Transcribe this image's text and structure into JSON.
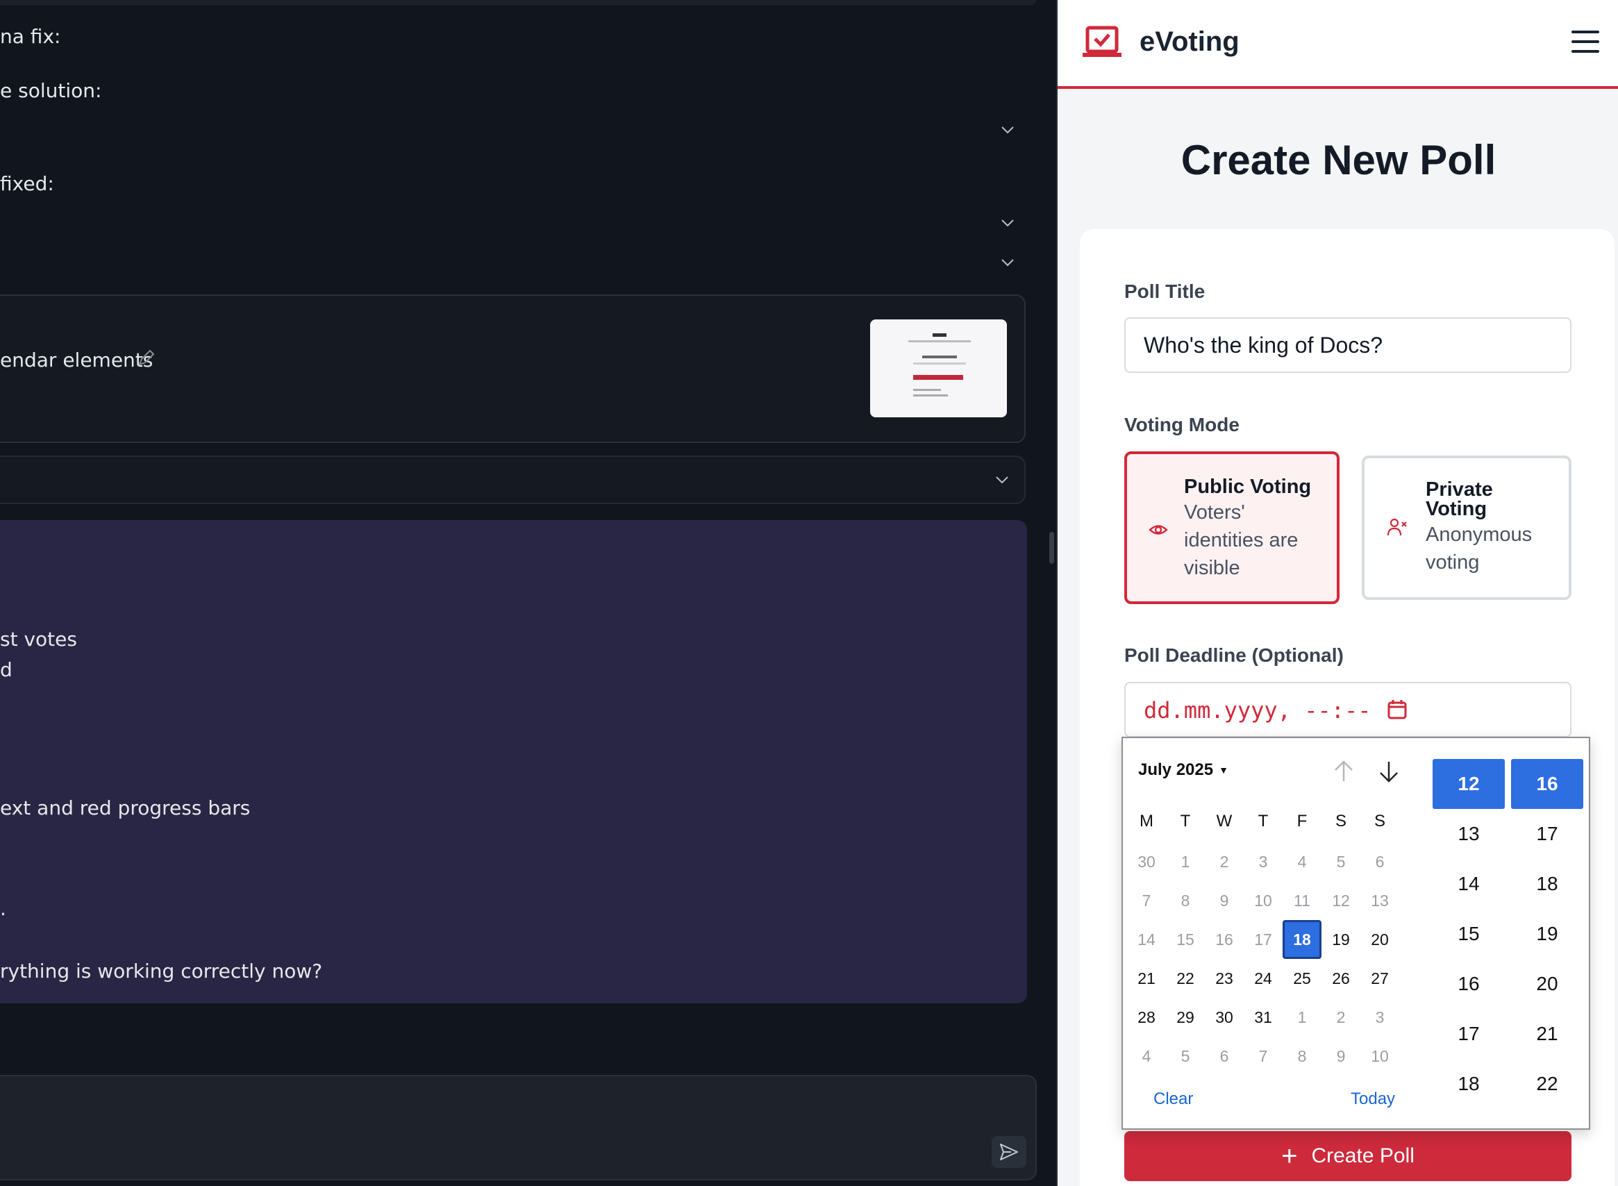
{
  "left_pane": {
    "lines": [
      {
        "text": "na fix:"
      },
      {
        "text": "e solution:"
      },
      {
        "text": "fixed:"
      },
      {
        "text": "endar elements"
      },
      {
        "text": "st votes"
      },
      {
        "text": "d"
      },
      {
        "text": "ext and red progress bars"
      },
      {
        "text": "."
      },
      {
        "text": "rything is working correctly now?"
      }
    ]
  },
  "app": {
    "brand": "eVoting",
    "page_title": "Create New Poll",
    "colors": {
      "accent": "#cd2a3c",
      "selection": "#2d6ee0"
    },
    "form": {
      "title_label": "Poll Title",
      "title_value": "Who's the king of Docs?",
      "mode_label": "Voting Mode",
      "modes": [
        {
          "name": "Public Voting",
          "description_lines": [
            "Voters'",
            "identities are",
            "visible"
          ],
          "icon": "eye-icon",
          "selected": true
        },
        {
          "name_lines": [
            "Private",
            "Voting"
          ],
          "description_lines": [
            "Anonymous",
            "voting"
          ],
          "icon": "user-x-icon",
          "selected": false
        }
      ],
      "deadline_label": "Poll Deadline (Optional)",
      "deadline_placeholder": "dd.mm.yyyy, --:--",
      "submit_label": "Create Poll"
    }
  },
  "picker": {
    "month_label": "July 2025",
    "weekdays": [
      "M",
      "T",
      "W",
      "T",
      "F",
      "S",
      "S"
    ],
    "weeks": [
      [
        {
          "d": "30",
          "s": "out"
        },
        {
          "d": "1",
          "s": "dis"
        },
        {
          "d": "2",
          "s": "dis"
        },
        {
          "d": "3",
          "s": "dis"
        },
        {
          "d": "4",
          "s": "dis"
        },
        {
          "d": "5",
          "s": "dis"
        },
        {
          "d": "6",
          "s": "dis"
        }
      ],
      [
        {
          "d": "7",
          "s": "dis"
        },
        {
          "d": "8",
          "s": "dis"
        },
        {
          "d": "9",
          "s": "dis"
        },
        {
          "d": "10",
          "s": "dis"
        },
        {
          "d": "11",
          "s": "dis"
        },
        {
          "d": "12",
          "s": "dis"
        },
        {
          "d": "13",
          "s": "dis"
        }
      ],
      [
        {
          "d": "14",
          "s": "dis"
        },
        {
          "d": "15",
          "s": "dis"
        },
        {
          "d": "16",
          "s": "dis"
        },
        {
          "d": "17",
          "s": "dis"
        },
        {
          "d": "18",
          "s": "sel"
        },
        {
          "d": "19",
          "s": "in"
        },
        {
          "d": "20",
          "s": "in"
        }
      ],
      [
        {
          "d": "21",
          "s": "in"
        },
        {
          "d": "22",
          "s": "in"
        },
        {
          "d": "23",
          "s": "in"
        },
        {
          "d": "24",
          "s": "in"
        },
        {
          "d": "25",
          "s": "in"
        },
        {
          "d": "26",
          "s": "in"
        },
        {
          "d": "27",
          "s": "in"
        }
      ],
      [
        {
          "d": "28",
          "s": "in"
        },
        {
          "d": "29",
          "s": "in"
        },
        {
          "d": "30",
          "s": "in"
        },
        {
          "d": "31",
          "s": "in"
        },
        {
          "d": "1",
          "s": "out"
        },
        {
          "d": "2",
          "s": "out"
        },
        {
          "d": "3",
          "s": "out"
        }
      ],
      [
        {
          "d": "4",
          "s": "out"
        },
        {
          "d": "5",
          "s": "out"
        },
        {
          "d": "6",
          "s": "out"
        },
        {
          "d": "7",
          "s": "out"
        },
        {
          "d": "8",
          "s": "out"
        },
        {
          "d": "9",
          "s": "out"
        },
        {
          "d": "10",
          "s": "out"
        }
      ]
    ],
    "clear_label": "Clear",
    "today_label": "Today",
    "hours": [
      "12",
      "13",
      "14",
      "15",
      "16",
      "17",
      "18"
    ],
    "minutes": [
      "16",
      "17",
      "18",
      "19",
      "20",
      "21",
      "22"
    ],
    "selected_hour": "12",
    "selected_minute": "16"
  }
}
